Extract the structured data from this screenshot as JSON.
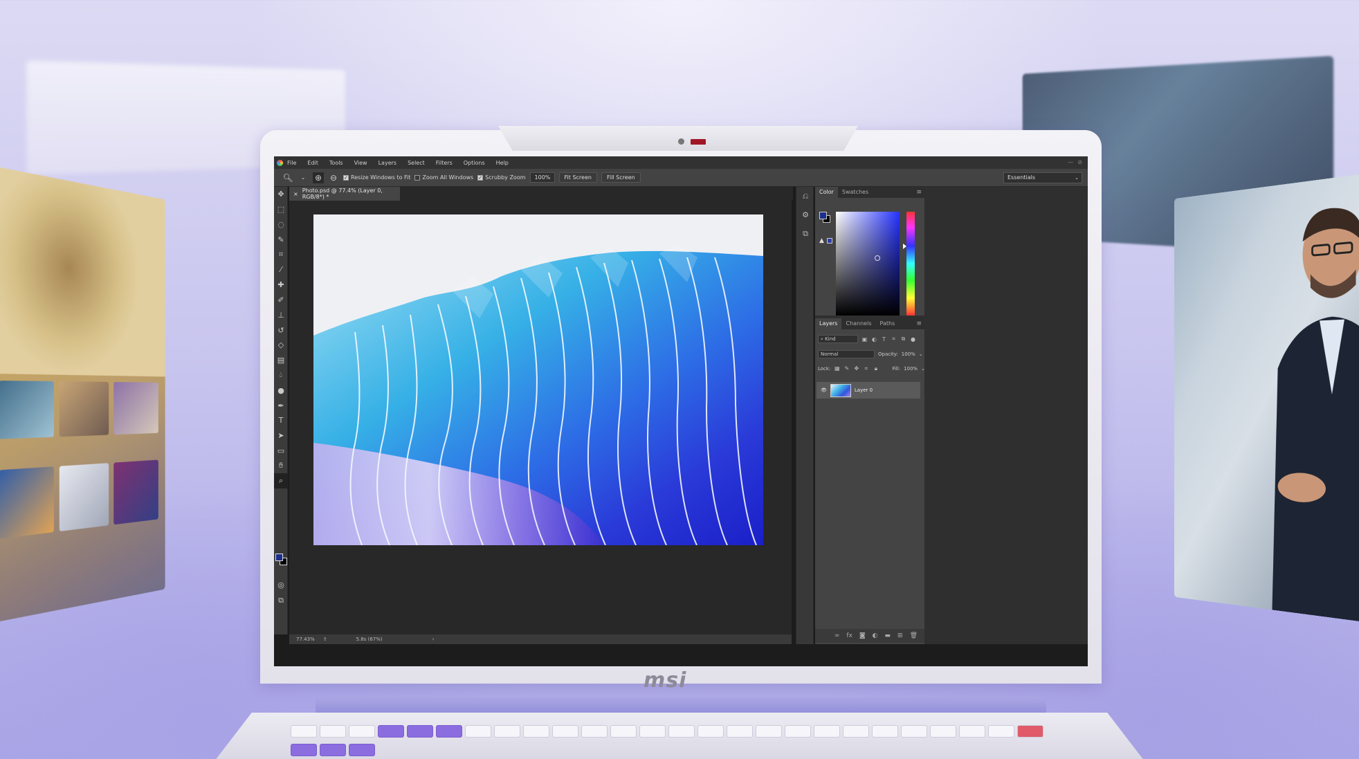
{
  "photoshop": {
    "menu": [
      "File",
      "Edit",
      "Tools",
      "View",
      "Layers",
      "Select",
      "Filters",
      "Options",
      "Help"
    ],
    "options_bar": {
      "resize_windows": "Resize Windows to Fit",
      "zoom_all": "Zoom All Windows",
      "scrubby_zoom": "Scrubby Zoom",
      "zoom_value": "100%",
      "fit_screen": "Fit Screen",
      "fill_screen": "Fill Screen",
      "workspace": "Essentials"
    },
    "document_tab": "Photo.psd @ 77.4% (Layer 0, RGB/8*) *",
    "status": {
      "zoom": "77.43%",
      "info": "5.8s (67%)"
    },
    "color_panel": {
      "tabs": [
        "Color",
        "Swatches"
      ]
    },
    "layers_panel": {
      "tabs": [
        "Layers",
        "Channels",
        "Paths"
      ],
      "kind": "Kind",
      "blend_mode": "Normal",
      "opacity_label": "Opacity:",
      "opacity_value": "100%",
      "lock_label": "Lock:",
      "fill_label": "Fill:",
      "fill_value": "100%",
      "layer_name": "Layer 0"
    }
  },
  "laptop": {
    "brand": "msi"
  },
  "colors": {
    "foreground": "#1c2f8c",
    "background": "#000000",
    "accent_key": "#8b6de0"
  }
}
